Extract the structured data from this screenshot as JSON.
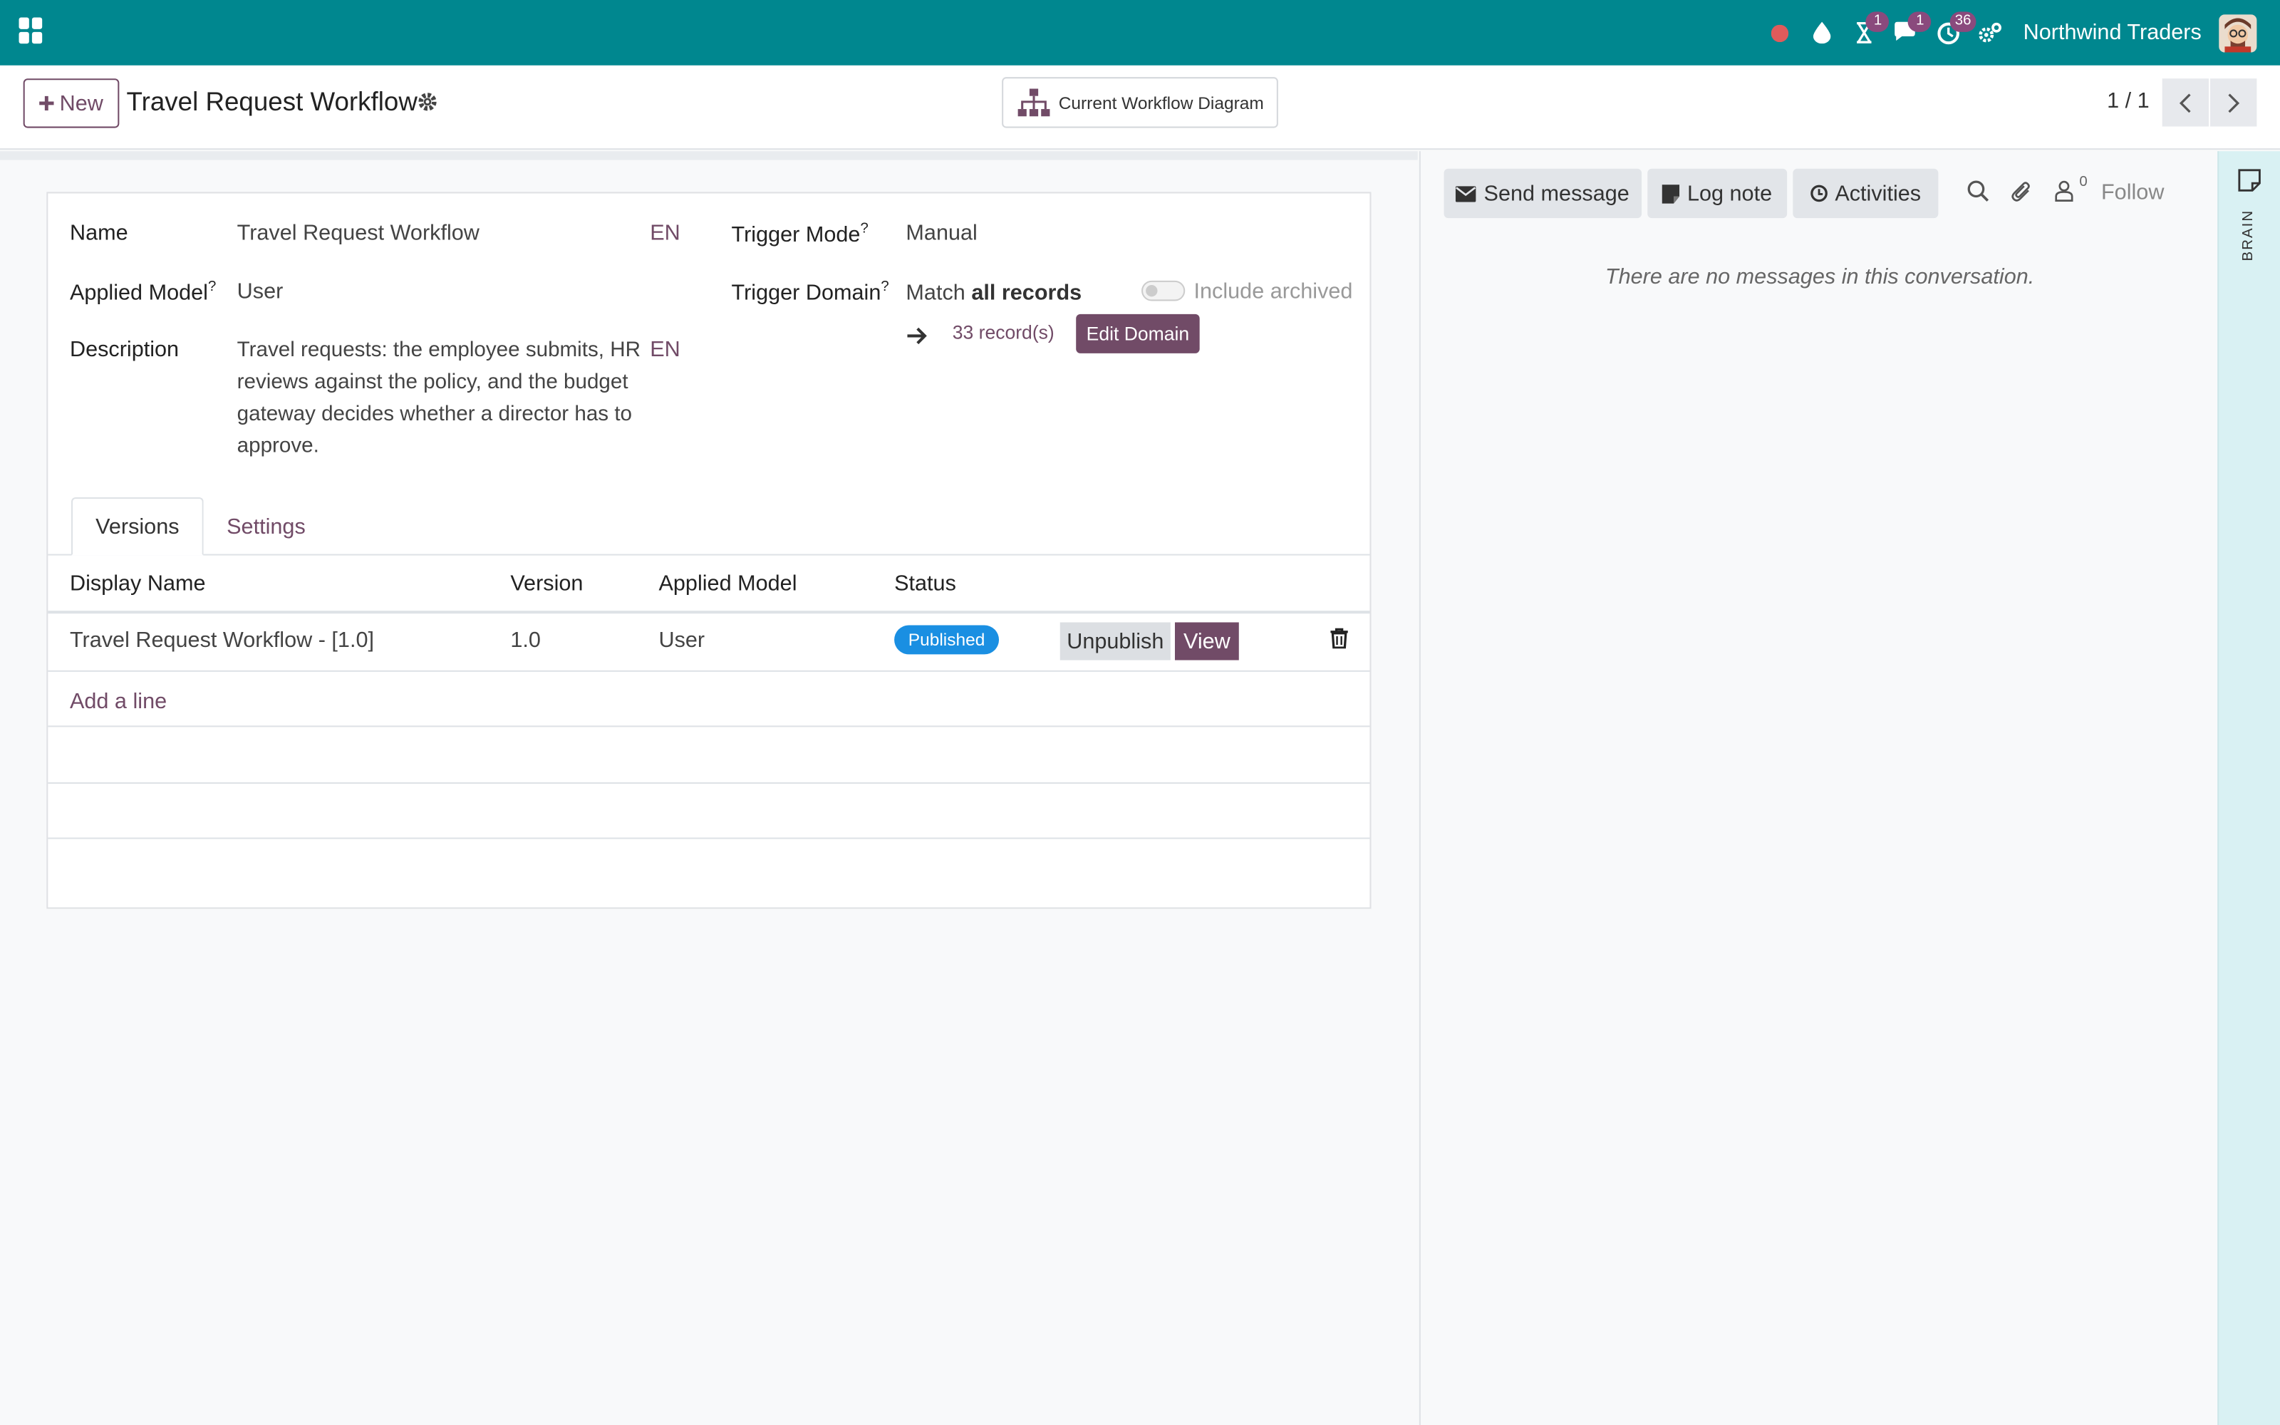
{
  "topbar": {
    "company_name": "Northwind Traders",
    "badges": {
      "activity": "1",
      "messages": "1",
      "clock": "36"
    },
    "colors": {
      "bar": "#00878f",
      "badge": "#8a4a7d",
      "record_dot": "#e05b5b"
    }
  },
  "control_panel": {
    "new_label": "New",
    "record_title": "Travel Request Workflow",
    "diagram_button": "Current Workflow Diagram",
    "pager": "1 / 1"
  },
  "form": {
    "name_label": "Name",
    "name_value": "Travel Request Workflow",
    "lang_tag": "EN",
    "applied_model_label": "Applied Model",
    "applied_model_value": "User",
    "description_label": "Description",
    "description_value": "Travel requests: the employee submits, HR reviews against the policy, and the budget gateway decides whether a director has to approve.",
    "help_mark": "?",
    "trigger_mode_label": "Trigger Mode",
    "trigger_mode_value": "Manual",
    "trigger_domain_label": "Trigger Domain",
    "domain_match_prefix": "Match",
    "domain_match_bold": "all records",
    "include_archived_label": "Include archived",
    "records_link": "33 record(s)",
    "edit_domain_button": "Edit Domain"
  },
  "tabs": [
    {
      "label": "Versions",
      "active": true
    },
    {
      "label": "Settings",
      "active": false
    }
  ],
  "versions_table": {
    "columns": [
      "Display Name",
      "Version",
      "Applied Model",
      "Status"
    ],
    "rows": [
      {
        "display_name": "Travel Request Workflow - [1.0]",
        "version": "1.0",
        "applied_model": "User",
        "status": "Published",
        "unpublish_label": "Unpublish",
        "view_label": "View"
      }
    ],
    "add_line_label": "Add a line"
  },
  "chatter": {
    "send_message": "Send message",
    "log_note": "Log note",
    "activities": "Activities",
    "follower_count": "0",
    "follow_label": "Follow",
    "empty_message": "There are no messages in this conversation."
  },
  "brain_panel": {
    "label": "BRAIN"
  },
  "accent_color": "#714b67"
}
